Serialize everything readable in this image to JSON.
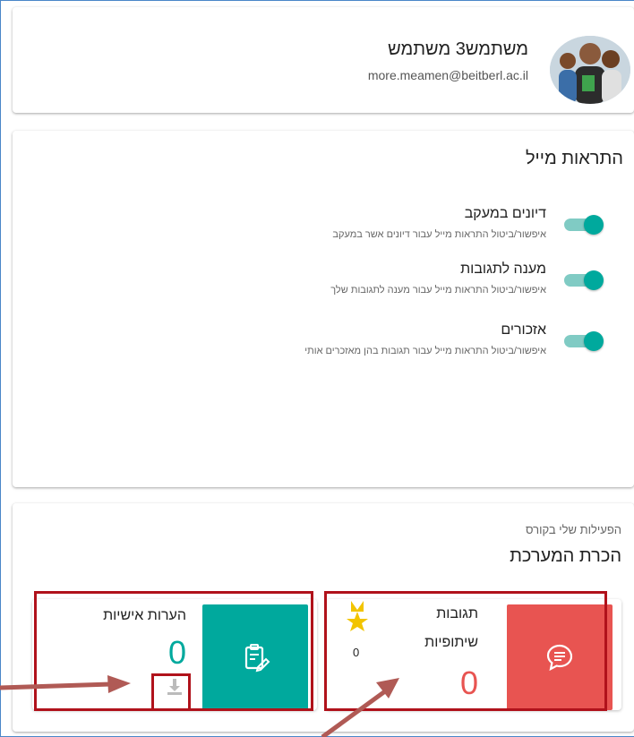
{
  "profile": {
    "name": "משתמש3 משתמש",
    "email": "more.meamen@beitberl.ac.il"
  },
  "notifications": {
    "title": "התראות מייל",
    "items": [
      {
        "title": "דיונים במעקב",
        "desc": "איפשור/ביטול התראות מייל עבור דיונים אשר במעקב",
        "enabled": true
      },
      {
        "title": "מענה לתגובות",
        "desc": "איפשור/ביטול התראות מייל עבור מענה לתגובות שלך",
        "enabled": true
      },
      {
        "title": "אזכורים",
        "desc": "איפשור/ביטול התראות מייל עבור תגובות בהן מאזכרים אותי",
        "enabled": true
      }
    ]
  },
  "activity": {
    "subtitle": "הפעילות שלי בקורס",
    "title": "הכרת המערכת",
    "discussions": {
      "label_line1": "תגובות",
      "label_line2": "שיתופיות",
      "count": "0",
      "badge_count": "0",
      "icon": "chat-bubble-icon",
      "color": "#e85451"
    },
    "notes": {
      "label": "הערות אישיות",
      "count": "0",
      "icon": "clipboard-edit-icon",
      "download_icon": "download-icon",
      "color": "#00a99d"
    }
  },
  "colors": {
    "accent_teal": "#00a99d",
    "accent_red": "#e85451",
    "annotation_red": "#b0121b",
    "arrow": "#b05a55"
  }
}
